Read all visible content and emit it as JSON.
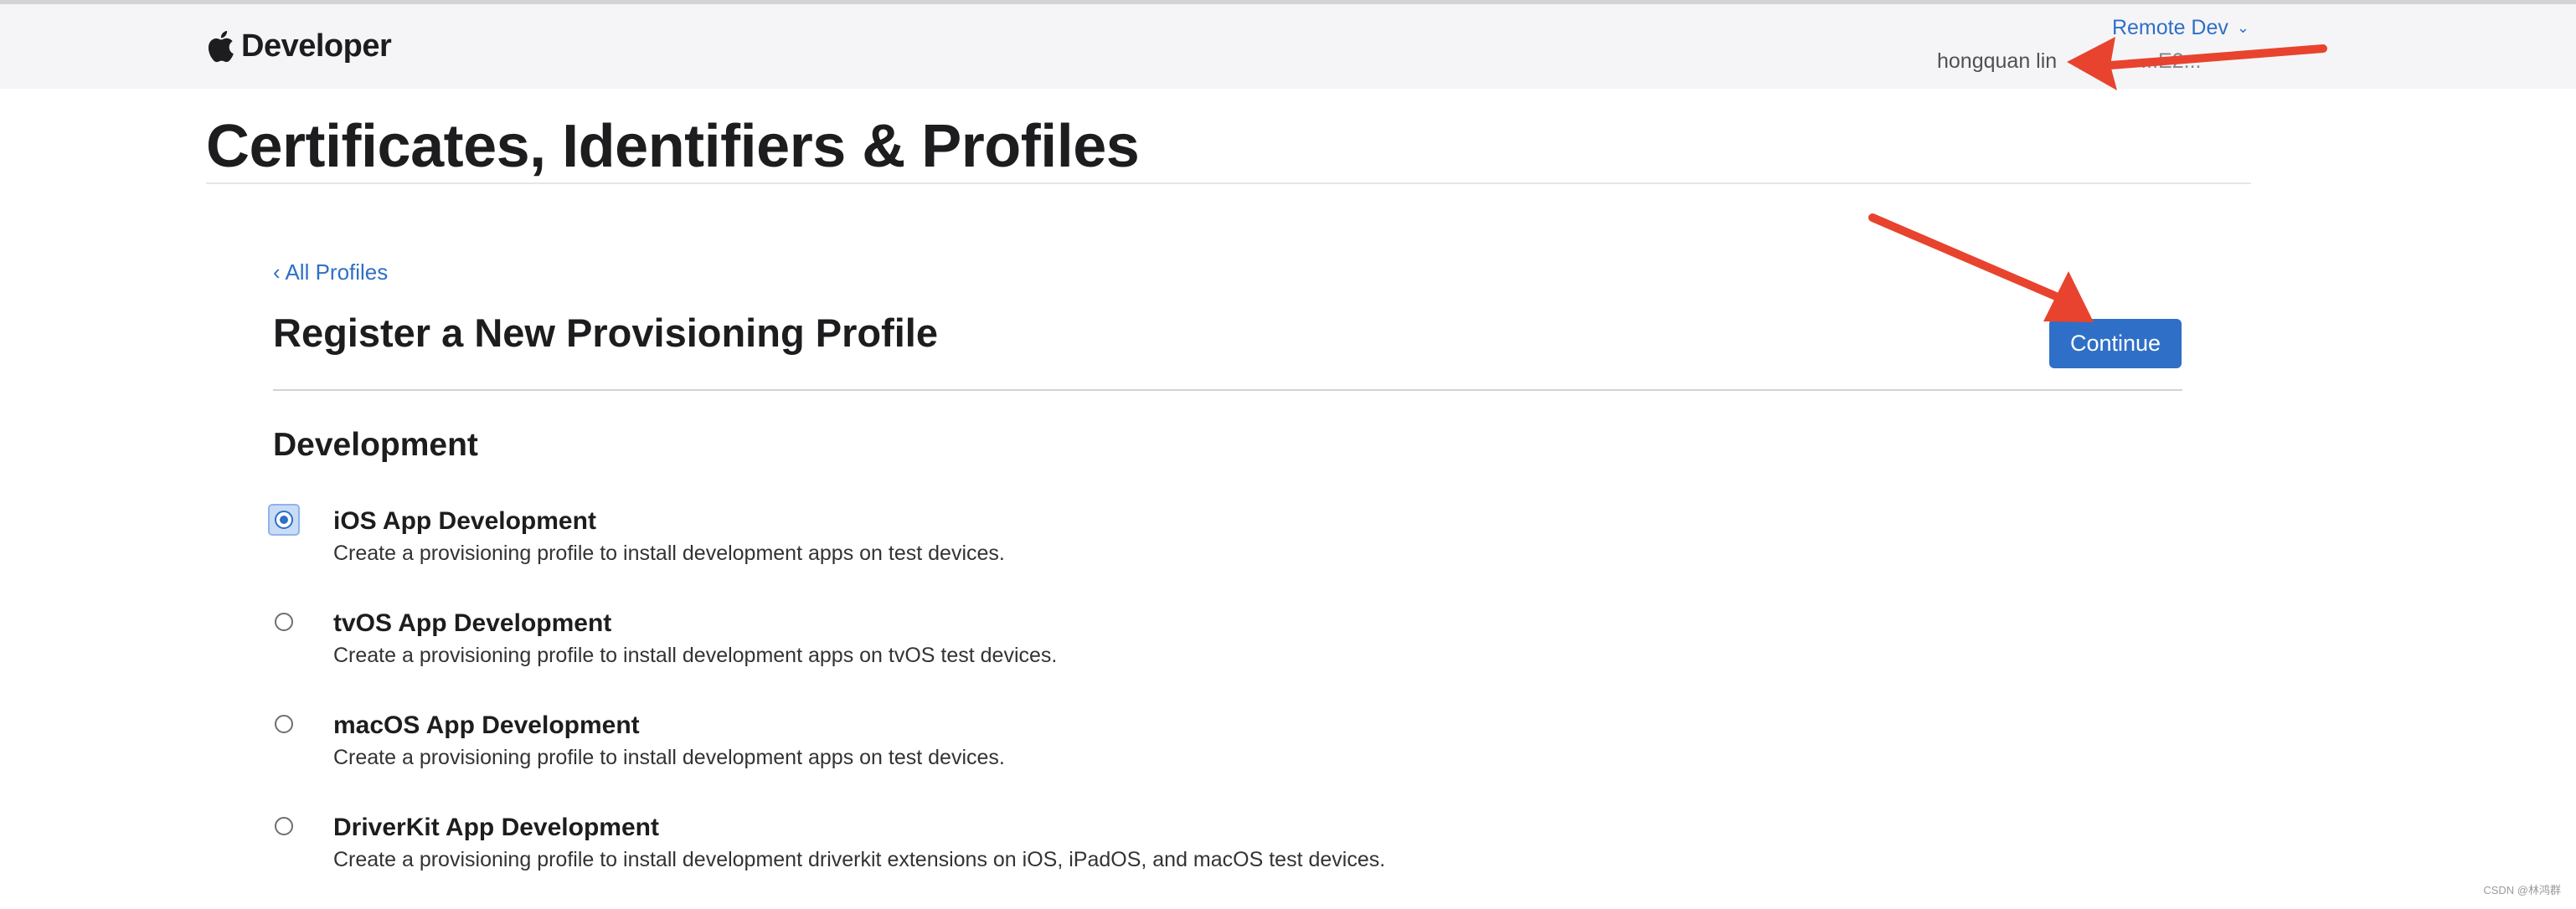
{
  "header": {
    "brand": "Developer",
    "team_switch": "Remote Dev",
    "user_name": "hongquan lin",
    "user_id_partial": "...E2..."
  },
  "page": {
    "title": "Certificates, Identifiers & Profiles"
  },
  "main": {
    "back_link": "‹ All Profiles",
    "section_title": "Register a New Provisioning Profile",
    "continue_label": "Continue",
    "group_title": "Development",
    "options": [
      {
        "label": "iOS App Development",
        "description": "Create a provisioning profile to install development apps on test devices.",
        "selected": true
      },
      {
        "label": "tvOS App Development",
        "description": "Create a provisioning profile to install development apps on tvOS test devices.",
        "selected": false
      },
      {
        "label": "macOS App Development",
        "description": "Create a provisioning profile to install development apps on test devices.",
        "selected": false
      },
      {
        "label": "DriverKit App Development",
        "description": "Create a provisioning profile to install development driverkit extensions on iOS, iPadOS, and macOS test devices.",
        "selected": false
      }
    ]
  },
  "watermark": "CSDN @林鸿群",
  "colors": {
    "accent": "#2f6fc7",
    "annotation_arrow": "#e8432e"
  }
}
